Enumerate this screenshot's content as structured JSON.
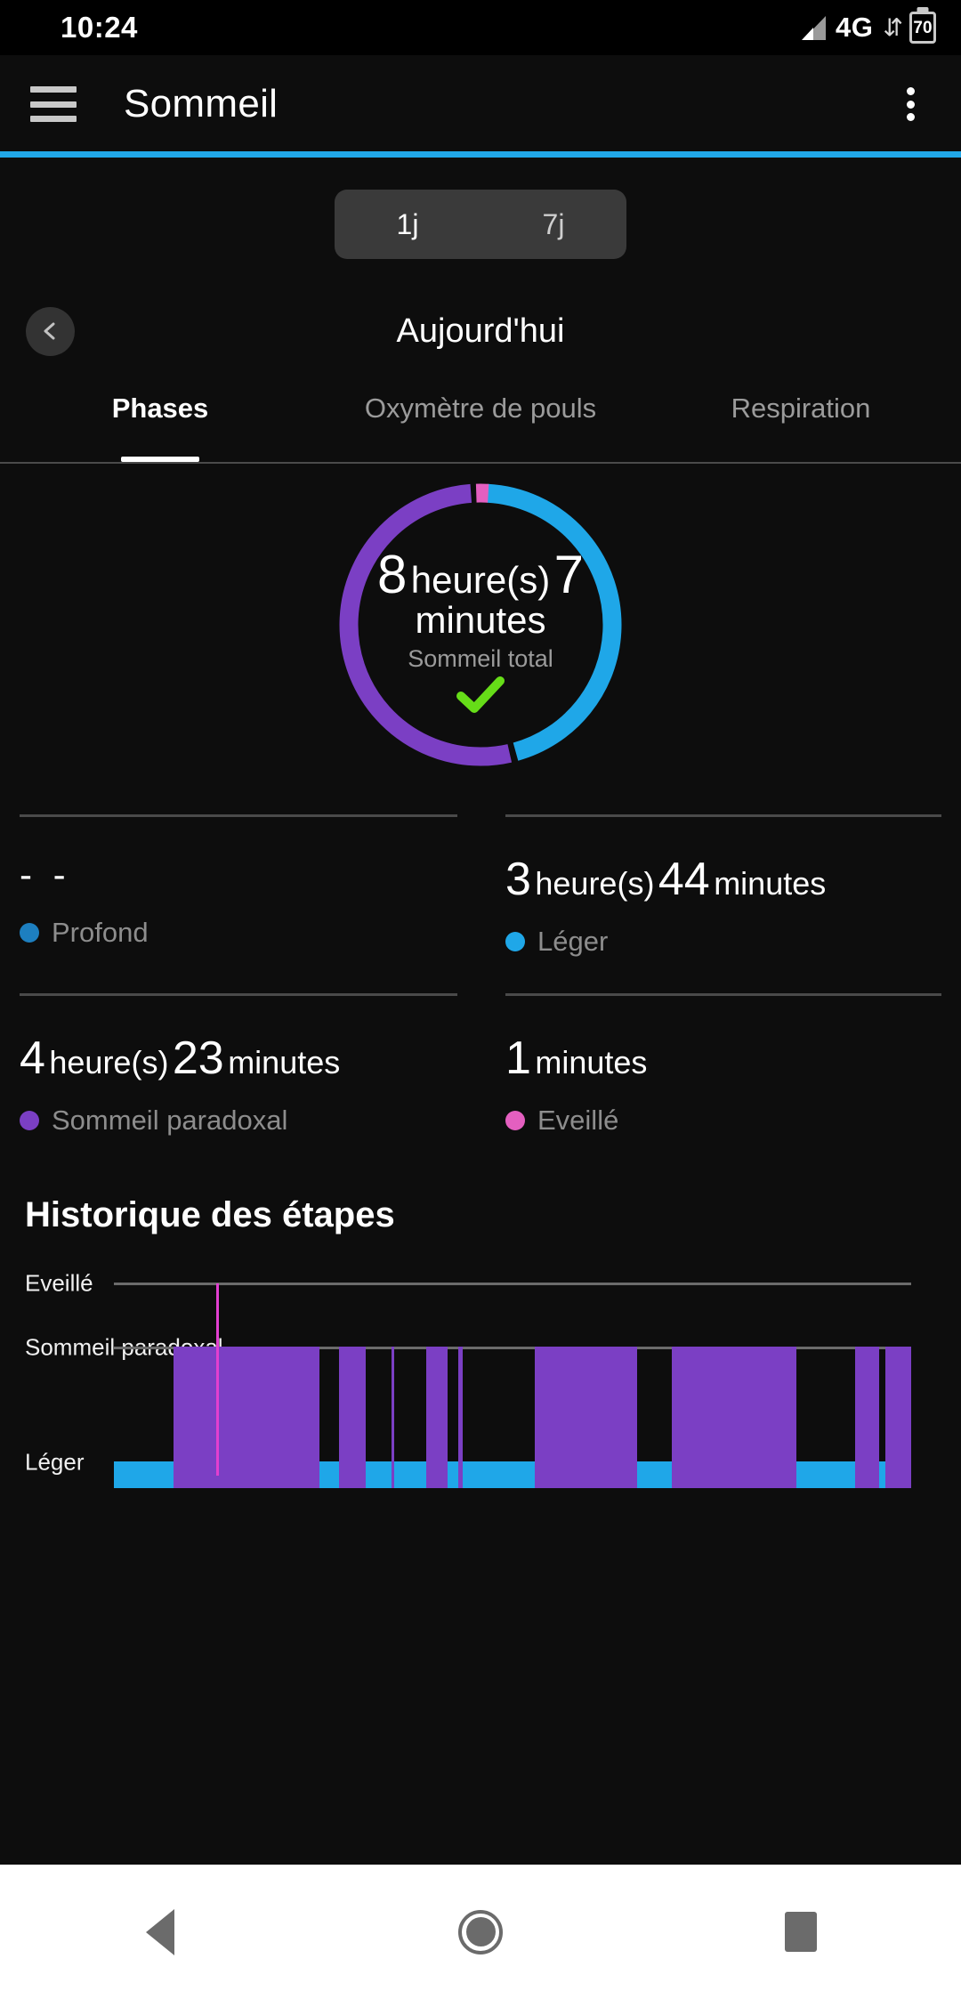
{
  "status_bar": {
    "time": "10:24",
    "network": "4G",
    "data_arrows": "⇵",
    "battery_level": "70",
    "signal_icon": "signal-bars-icon"
  },
  "app_bar": {
    "menu_icon": "hamburger-menu-icon",
    "title": "Sommeil",
    "overflow_icon": "overflow-menu-icon"
  },
  "range_selector": {
    "options": [
      {
        "label": "1j",
        "selected": true
      },
      {
        "label": "7j",
        "selected": false
      }
    ]
  },
  "date_nav": {
    "prev_icon": "chevron-left-icon",
    "label": "Aujourd'hui"
  },
  "tabs": [
    {
      "label": "Phases",
      "active": true
    },
    {
      "label": "Oxymètre de pouls",
      "active": false
    },
    {
      "label": "Respiration",
      "active": false
    }
  ],
  "summary": {
    "hours": "8",
    "hours_unit": "heure(s)",
    "minutes": "7",
    "minutes_unit": "minutes",
    "caption": "Sommeil total",
    "goal_icon": "check-mark-icon"
  },
  "stats": [
    {
      "value_text": "- -",
      "is_empty": true,
      "name": "Profond",
      "color": "#1d7fc0"
    },
    {
      "hours": "3",
      "hours_unit": "heure(s)",
      "minutes": "44",
      "minutes_unit": "minutes",
      "is_empty": false,
      "name": "Léger",
      "color": "#1fa7e8"
    },
    {
      "hours": "4",
      "hours_unit": "heure(s)",
      "minutes": "23",
      "minutes_unit": "minutes",
      "is_empty": false,
      "name": "Sommeil paradoxal",
      "color": "#7b3fc4"
    },
    {
      "minutes": "1",
      "minutes_unit": "minutes",
      "is_empty": false,
      "name": "Eveillé",
      "color": "#e45fc0"
    }
  ],
  "history": {
    "title": "Historique des étapes",
    "axis_labels": [
      "Eveillé",
      "Sommeil paradoxal",
      "Léger"
    ]
  },
  "nav_bar": {
    "back_icon": "back-triangle-icon",
    "home_icon": "home-circle-icon",
    "recents_icon": "recents-square-icon"
  },
  "colors": {
    "accent": "#21a7e8",
    "deep": "#1d7fc0",
    "light": "#1fa7e8",
    "rem": "#7b3fc4",
    "awake": "#e45fc0",
    "goal_check": "#66dd18",
    "background": "#0d0d0d"
  },
  "chart_data": [
    {
      "type": "pie",
      "title": "Sommeil total",
      "subtitle": "8 heure(s) 7 minutes",
      "labels": [
        "Léger",
        "Sommeil paradoxal",
        "Eveillé",
        "Profond"
      ],
      "values": [
        224,
        263,
        1,
        0
      ],
      "value_unit": "minutes",
      "colors": [
        "#1fa7e8",
        "#7b3fc4",
        "#e45fc0",
        "#1d7fc0"
      ],
      "total": 488,
      "legend_position": "below",
      "donut": true
    },
    {
      "type": "bar",
      "title": "Historique des étapes",
      "ylabel": "",
      "xlabel": "",
      "categories": [
        "Eveillé",
        "Sommeil paradoxal",
        "Léger"
      ],
      "grid": false,
      "legend_position": "none",
      "segments": [
        {
          "stage": "Léger",
          "start": 0.0,
          "end": 0.075,
          "color": "#1fa7e8"
        },
        {
          "stage": "Sommeil paradoxal",
          "start": 0.075,
          "end": 0.258,
          "color": "#7b3fc4"
        },
        {
          "stage": "Léger",
          "start": 0.258,
          "end": 0.282,
          "color": "#1fa7e8"
        },
        {
          "stage": "Sommeil paradoxal",
          "start": 0.282,
          "end": 0.316,
          "color": "#7b3fc4"
        },
        {
          "stage": "Léger",
          "start": 0.316,
          "end": 0.348,
          "color": "#1fa7e8"
        },
        {
          "stage": "Sommeil paradoxal",
          "start": 0.348,
          "end": 0.352,
          "color": "#7b3fc4"
        },
        {
          "stage": "Léger",
          "start": 0.352,
          "end": 0.392,
          "color": "#1fa7e8"
        },
        {
          "stage": "Sommeil paradoxal",
          "start": 0.392,
          "end": 0.418,
          "color": "#7b3fc4"
        },
        {
          "stage": "Léger",
          "start": 0.418,
          "end": 0.432,
          "color": "#1fa7e8"
        },
        {
          "stage": "Sommeil paradoxal",
          "start": 0.432,
          "end": 0.438,
          "color": "#7b3fc4"
        },
        {
          "stage": "Léger",
          "start": 0.438,
          "end": 0.528,
          "color": "#1fa7e8"
        },
        {
          "stage": "Sommeil paradoxal",
          "start": 0.528,
          "end": 0.656,
          "color": "#7b3fc4"
        },
        {
          "stage": "Léger",
          "start": 0.656,
          "end": 0.7,
          "color": "#1fa7e8"
        },
        {
          "stage": "Sommeil paradoxal",
          "start": 0.7,
          "end": 0.856,
          "color": "#7b3fc4"
        },
        {
          "stage": "Léger",
          "start": 0.856,
          "end": 0.93,
          "color": "#1fa7e8"
        },
        {
          "stage": "Sommeil paradoxal",
          "start": 0.93,
          "end": 0.96,
          "color": "#7b3fc4"
        },
        {
          "stage": "Léger",
          "start": 0.96,
          "end": 0.968,
          "color": "#1fa7e8"
        },
        {
          "stage": "Sommeil paradoxal",
          "start": 0.968,
          "end": 1.0,
          "color": "#7b3fc4"
        }
      ],
      "cursor_position": 0.128
    }
  ]
}
